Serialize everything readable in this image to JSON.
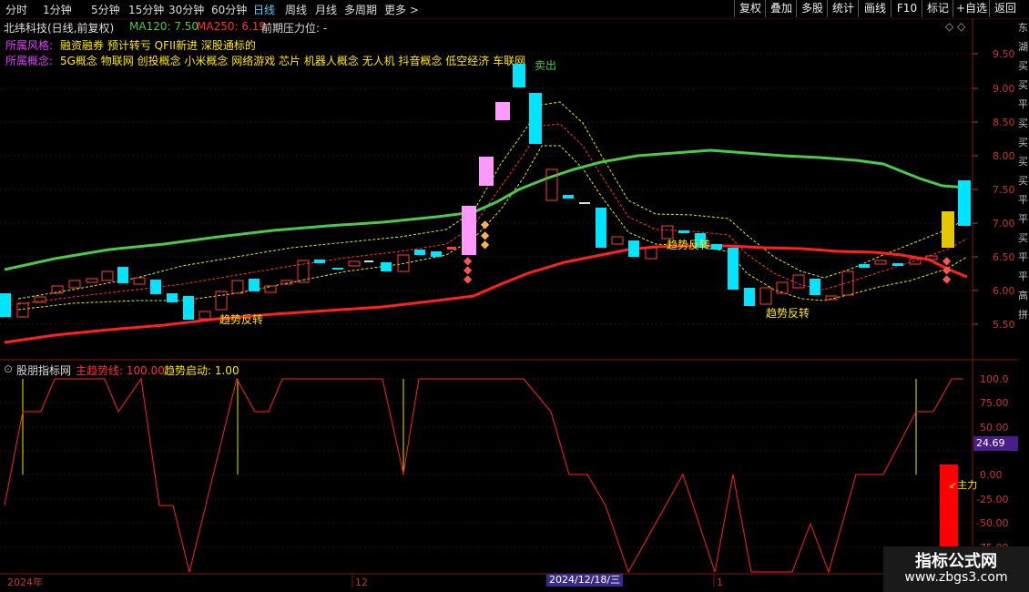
{
  "toolbar": {
    "periods": [
      "分时",
      "1分钟",
      "5分钟",
      "15分钟",
      "30分钟",
      "60分钟",
      "日线",
      "周线",
      "月线",
      "多周期",
      "更多 >"
    ],
    "active_period": "日线",
    "buttons": [
      "复权",
      "叠加",
      "多股",
      "统计",
      "画线",
      "F10",
      "标记",
      "+自选",
      "返回"
    ]
  },
  "main": {
    "stock_title": "北纬科技(日线,前复权)",
    "ma120": "MA120: 7.50",
    "ma250": "MA250: 6.19",
    "pressure": "前期压力位: -",
    "style_label": "所属风格:",
    "style_value": "融资融券 预计转亏 QFII新进 深股通标的",
    "concept_label": "所属概念:",
    "concept_value": "5G概念 物联网 创投概念 小米概念 网络游戏 芯片 机器人概念 无人机 抖音概念 低空经济 车联网",
    "annotations": {
      "sell": "卖出",
      "reversal": "趋势反转"
    },
    "price_ticks": [
      "9.50",
      "9.00",
      "8.50",
      "8.00",
      "7.50",
      "7.00",
      "6.50",
      "6.00",
      "5.50"
    ]
  },
  "indicator": {
    "name": "股朋指标网",
    "main_line": "主趋势线: 100.00",
    "start": "趋势启动: 1.00",
    "ticks": [
      "100.0",
      "75.00",
      "50.00",
      "25.00",
      "0.00",
      "-25.00",
      "-50.00",
      "-75.00"
    ],
    "current_value": "24.69",
    "main_force_label": "主力"
  },
  "side_text": "东湖买买平买买买买平平买平平高拼",
  "dates": {
    "year": "2024年",
    "m12": "12",
    "selected": "2024/12/18/三",
    "m1": "1"
  },
  "watermark": {
    "title": "指标公式网",
    "url": "www.zbgs3.com"
  },
  "colors": {
    "up": "#ff3b3b",
    "down": "#00e5ff",
    "ma120": "#4cc84c",
    "ma250": "#ff2020",
    "band": "#e8e800",
    "accent": "#4fd1ff"
  }
}
